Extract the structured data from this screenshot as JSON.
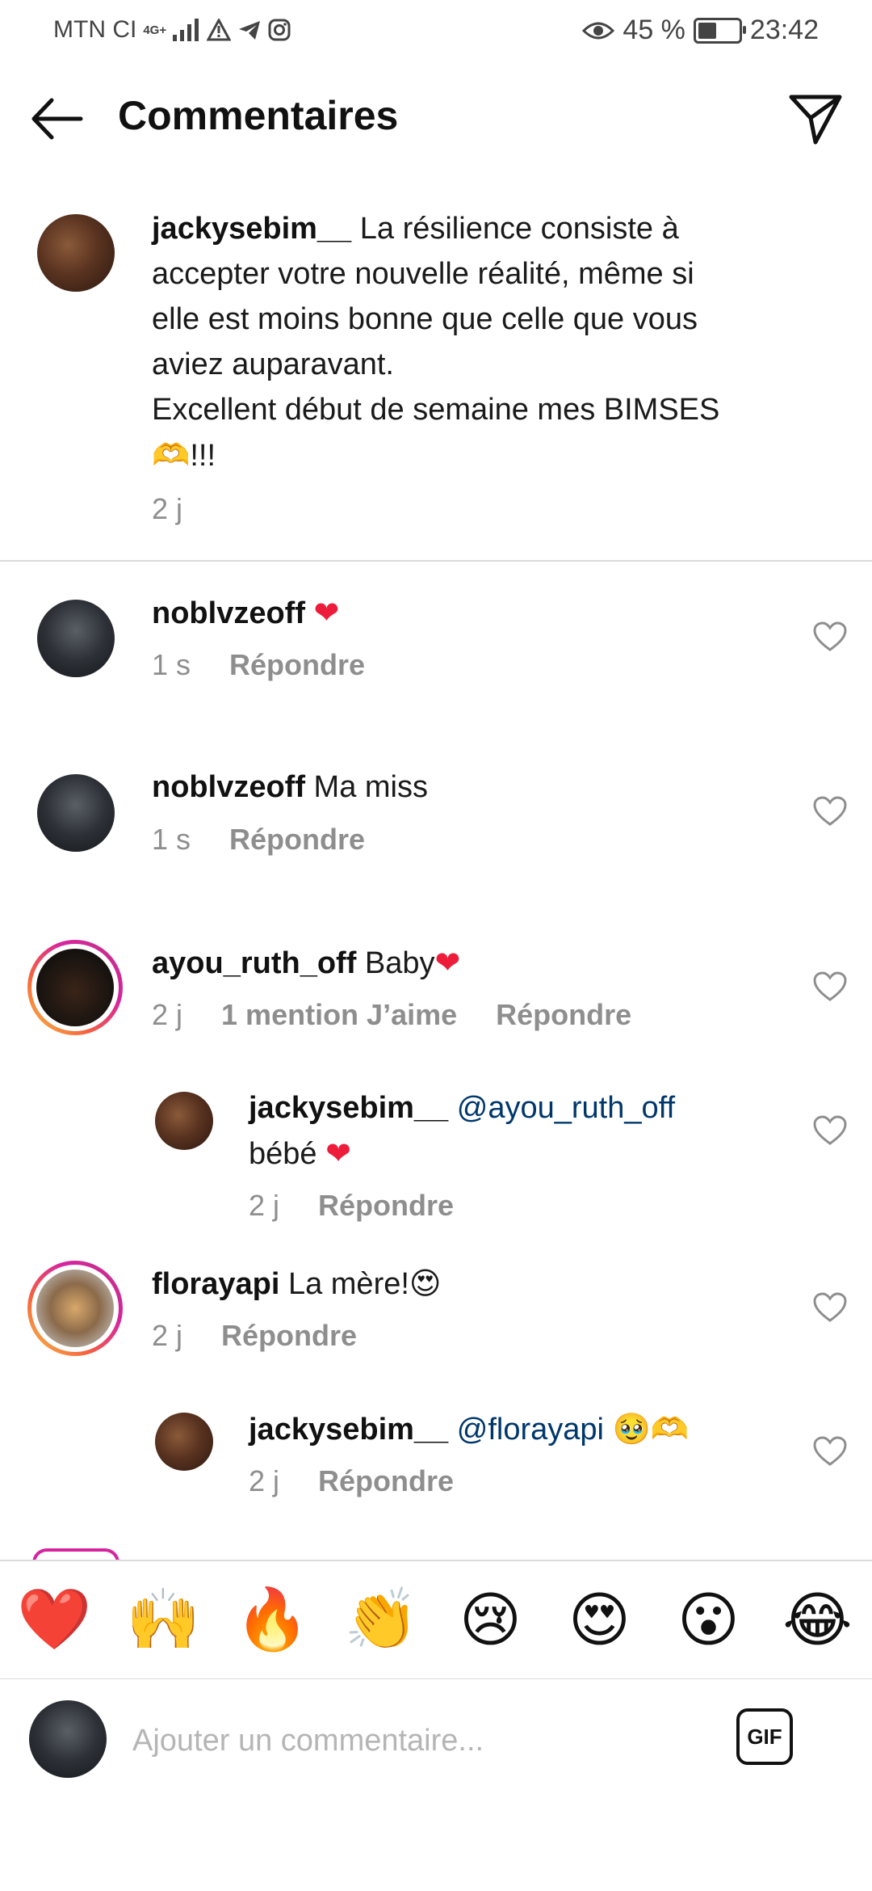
{
  "status_bar": {
    "carrier": "MTN CI",
    "network": "4G+",
    "battery": "45 %",
    "battery_level": 0.45,
    "time": "23:42"
  },
  "header": {
    "title": "Commentaires",
    "back_icon": "arrow-left-icon",
    "send_icon": "paper-plane-icon"
  },
  "caption": {
    "username": "jackysebim__",
    "text_lines": [
      "La résilience consiste à",
      "accepter votre nouvelle réalité, même si",
      "elle est moins bonne que celle que vous",
      "aviez auparavant.",
      "Excellent début de semaine mes BIMSES"
    ],
    "emoji_suffix": "🫶",
    "suffix": "!!!",
    "time": "2 j"
  },
  "comments": [
    {
      "username": "noblvzeoff",
      "text": "",
      "emoji": "❤",
      "time": "1 s",
      "likes": "",
      "reply": "Répondre"
    },
    {
      "username": "noblvzeoff",
      "text": "Ma miss",
      "emoji": "",
      "time": "1 s",
      "likes": "",
      "reply": "Répondre"
    },
    {
      "username": "ayou_ruth_off",
      "text": "Baby",
      "emoji": "❤",
      "time": "2 j",
      "likes": "1 mention J’aime",
      "reply": "Répondre"
    },
    {
      "username": "jackysebim__",
      "mention": "@ayou_ruth_off",
      "text": "bébé",
      "emoji": "❤",
      "time": "2 j",
      "likes": "",
      "reply": "Répondre"
    },
    {
      "username": "florayapi",
      "text": "La mère!",
      "emoji": "😍",
      "time": "2 j",
      "likes": "",
      "reply": "Répondre"
    },
    {
      "username": "jackysebim__",
      "mention": "@florayapi",
      "text": "",
      "emoji": "🥹🫶",
      "time": "2 j",
      "likes": "",
      "reply": "Répondre"
    }
  ],
  "reactions": [
    "❤️",
    "🙌",
    "🔥",
    "👏",
    "😢",
    "😍",
    "😮",
    "😂"
  ],
  "composer": {
    "placeholder": "Ajouter un commentaire...",
    "gif_label": "GIF"
  }
}
